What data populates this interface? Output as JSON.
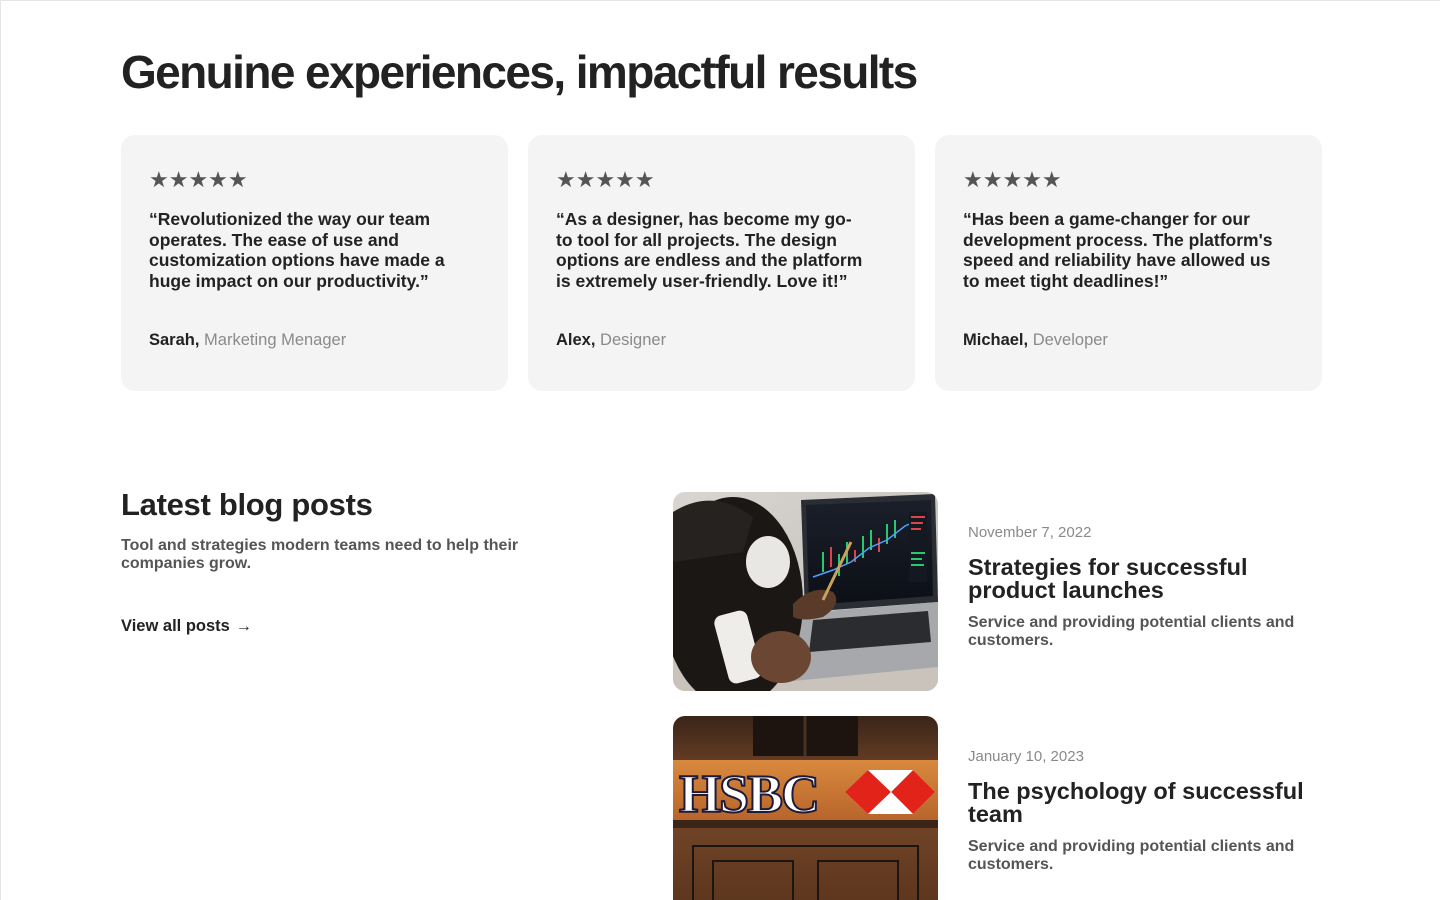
{
  "testimonials": {
    "title": "Genuine experiences, impactful results",
    "items": [
      {
        "stars": "★★★★★",
        "quote": "“Revolutionized the way our team operates. The ease of use and customization options have made a huge impact on our productivity.”",
        "name": "Sarah,",
        "role": "Marketing Menager"
      },
      {
        "stars": "★★★★★",
        "quote": "“As a designer, has become my go-to tool for all projects. The design options are endless and the platform is extremely user-friendly. Love it!”",
        "name": "Alex,",
        "role": "Designer"
      },
      {
        "stars": "★★★★★",
        "quote": "“Has been a game-changer for our development process. The platform's speed and reliability have allowed us to meet tight deadlines!”",
        "name": "Michael,",
        "role": "Developer"
      }
    ]
  },
  "blog": {
    "title": "Latest blog posts",
    "subtitle": "Tool and strategies modern teams need to help their companies grow.",
    "view_all": "View all posts",
    "arrow": "→",
    "posts": [
      {
        "date": "November 7, 2022",
        "title": "Strategies for successful product launches",
        "desc": "Service and providing potential clients and customers."
      },
      {
        "date": "January 10, 2023",
        "title": "The psychology of successful team",
        "desc": "Service and providing potential clients and customers."
      }
    ],
    "sign_text": "HSBC"
  },
  "colors": {
    "card_bg": "#f4f4f5",
    "muted": "#8a8a8a",
    "text": "#222222"
  }
}
